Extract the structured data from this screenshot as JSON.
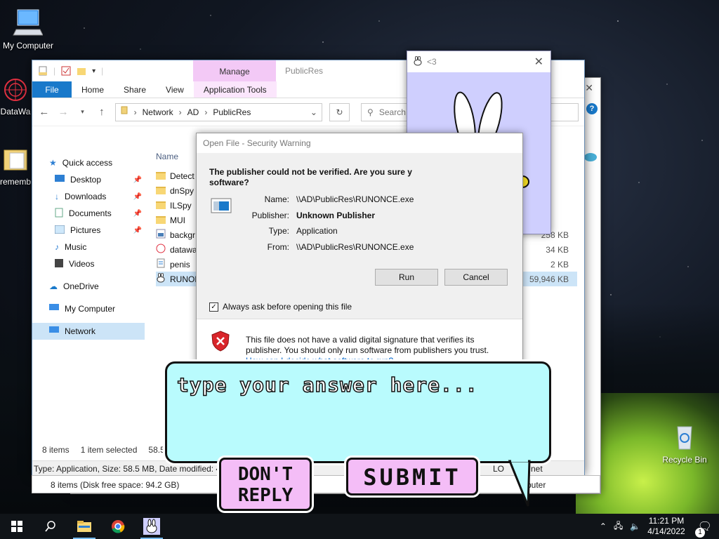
{
  "desktop": {
    "icons": [
      {
        "label": "My Computer",
        "icon": "computer-icon"
      },
      {
        "label": "DataWa",
        "icon": "datawave-icon"
      },
      {
        "label": "rememb",
        "icon": "folder-icon"
      },
      {
        "label": "Recycle Bin",
        "icon": "recycle-bin-icon"
      }
    ]
  },
  "explorer": {
    "title": "PublicRes",
    "manage_tab": "Manage",
    "ribbon_tabs": [
      "File",
      "Home",
      "Share",
      "View",
      "Application Tools"
    ],
    "address": [
      "Network",
      "AD",
      "PublicRes"
    ],
    "search_placeholder": "Search Publi",
    "sidebar": {
      "quick_access": "Quick access",
      "items": [
        "Desktop",
        "Downloads",
        "Documents",
        "Pictures",
        "Music",
        "Videos"
      ],
      "onedrive": "OneDrive",
      "my_computer": "My Computer",
      "network": "Network"
    },
    "column_name": "Name",
    "files": [
      {
        "name": "Detect",
        "size": "",
        "icon": "folder-icon"
      },
      {
        "name": "dnSpy",
        "size": "",
        "icon": "folder-icon"
      },
      {
        "name": "ILSpy",
        "size": "",
        "icon": "folder-icon"
      },
      {
        "name": "MUI",
        "size": "",
        "icon": "folder-icon"
      },
      {
        "name": "backgr",
        "size": "258 KB",
        "icon": "image-file-icon"
      },
      {
        "name": "datawa",
        "size": "34 KB",
        "icon": "datawave-icon"
      },
      {
        "name": "penis",
        "size": "2 KB",
        "icon": "text-file-icon"
      },
      {
        "name": "RUNON",
        "size": "59,946 KB",
        "icon": "bunny-exe-icon"
      }
    ],
    "status_items": "8 items",
    "status_selected": "1 item selected",
    "status_size": "58.5 M",
    "details_bar": "Type: Application, Size: 58.5 MB, Date modified: 4/",
    "details_bar_right": "net",
    "details_bar_lo": "LO",
    "bottom_status": "8 items (Disk free space: 94.2 GB)",
    "bottom_status_right": "puter"
  },
  "bunny_window": {
    "title": "<3"
  },
  "dialog": {
    "title": "Open File - Security Warning",
    "heading": "The publisher could not be verified.  Are you sure y… software?",
    "heading_line1": "The publisher could not be verified.  Are you sure y",
    "heading_line2": "software?",
    "name_label": "Name:",
    "name_value": "\\\\AD\\PublicRes\\RUNONCE.exe",
    "publisher_label": "Publisher:",
    "publisher_value": "Unknown Publisher",
    "type_label": "Type:",
    "type_value": "Application",
    "from_label": "From:",
    "from_value": "\\\\AD\\PublicRes\\RUNONCE.exe",
    "run": "Run",
    "cancel": "Cancel",
    "checkbox_label": "Always ask before opening this file",
    "checkbox_checked": true,
    "warning_text": "This file does not have a valid digital signature that verifies its publisher.  You should only run software from publishers you trust.",
    "link": "How can I decide what software to run?"
  },
  "bubble": {
    "placeholder": "type your answer here...",
    "dont_reply_line1": "DON'T",
    "dont_reply_line2": "REPLY",
    "submit": "SUBMIT"
  },
  "taskbar": {
    "time": "11:21 PM",
    "date": "4/14/2022",
    "notification_count": "1"
  },
  "colors": {
    "accent": "#1979ca",
    "manage_tab": "#f3c9f6",
    "bunny_bg": "#cfcffe",
    "bubble_bg": "#b9fbfd",
    "pink_button": "#f4bdf7"
  }
}
